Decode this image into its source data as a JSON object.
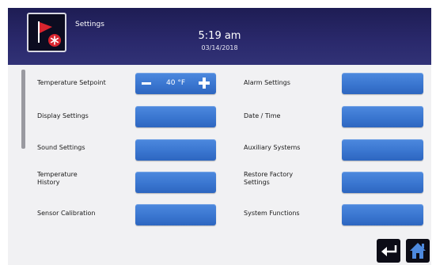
{
  "header": {
    "app_label": "Settings",
    "time": "5:19 am",
    "date": "03/14/2018",
    "logo_icon": "red-flag-snowflake-icon"
  },
  "settings": {
    "temperature_setpoint": {
      "label": "Temperature Setpoint",
      "value": "40 °F"
    },
    "display_settings": {
      "label": "Display Settings"
    },
    "sound_settings": {
      "label": "Sound Settings"
    },
    "temperature_history": {
      "label_line1": "Temperature",
      "label_line2": "History"
    },
    "sensor_calibration": {
      "label": "Sensor Calibration"
    },
    "alarm_settings": {
      "label": "Alarm Settings"
    },
    "date_time": {
      "label": "Date / Time"
    },
    "auxiliary_systems": {
      "label": "Auxiliary Systems"
    },
    "restore_factory": {
      "label_line1": "Restore Factory",
      "label_line2": "Settings"
    },
    "system_functions": {
      "label": "System Functions"
    }
  },
  "footer": {
    "back_icon": "back-arrow-icon",
    "home_icon": "home-icon"
  },
  "colors": {
    "header_bg": "#2a296c",
    "button_blue": "#3a76d0",
    "content_bg": "#f1f1f3",
    "logo_red": "#d8242e"
  }
}
